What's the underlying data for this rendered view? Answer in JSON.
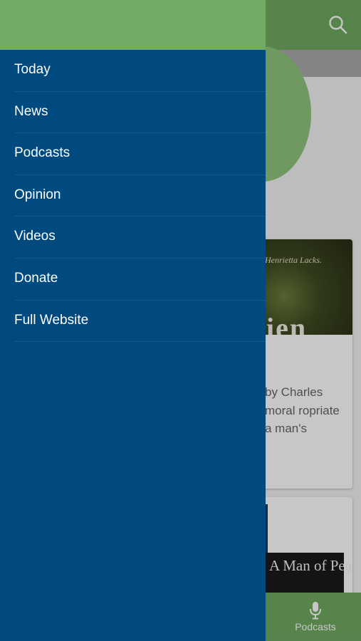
{
  "app": {
    "search_icon": "search-icon",
    "card1": {
      "caption": "Henrietta Lacks.",
      "big_text": "ien",
      "excerpt": "by Charles moral ropriate a man's"
    },
    "card2": {
      "title": "A Man of Peace"
    },
    "tabbar": {
      "podcasts_label": "Podcasts",
      "podcasts_icon": "microphone-icon"
    }
  },
  "drawer": {
    "menu": [
      {
        "label": "Today"
      },
      {
        "label": "News"
      },
      {
        "label": "Podcasts"
      },
      {
        "label": "Opinion"
      },
      {
        "label": "Videos"
      },
      {
        "label": "Donate"
      },
      {
        "label": "Full Website"
      }
    ]
  },
  "colors": {
    "drawer_bg": "#004a80",
    "header_green": "#6fa961",
    "accent_green": "#8fc47b"
  }
}
